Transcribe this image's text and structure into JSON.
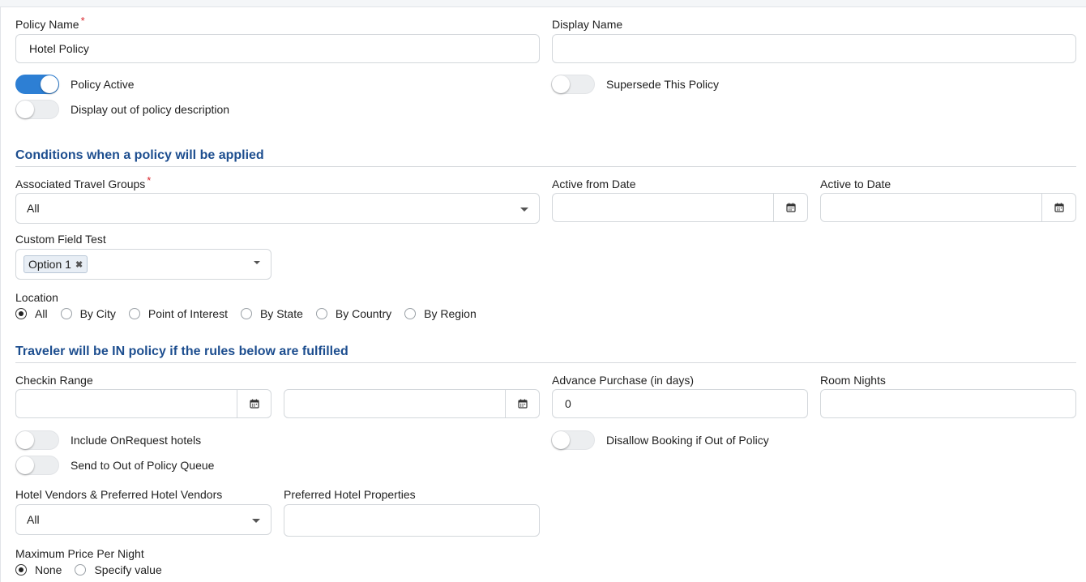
{
  "general": {
    "policy_name_label": "Policy Name",
    "policy_name_value": "Hotel Policy",
    "display_name_label": "Display Name",
    "display_name_value": "",
    "required_mark": "*",
    "policy_active_label": "Policy Active",
    "policy_active_on": true,
    "supersede_label": "Supersede This Policy",
    "supersede_on": false,
    "display_oop_label": "Display out of policy description",
    "display_oop_on": false
  },
  "conditions": {
    "title": "Conditions when a policy will be applied",
    "travel_groups_label": "Associated Travel Groups",
    "travel_groups_value": "All",
    "active_from_label": "Active from Date",
    "active_from_value": "",
    "active_to_label": "Active to Date",
    "active_to_value": "",
    "custom_field_label": "Custom Field Test",
    "custom_field_chip": "Option 1",
    "location_label": "Location",
    "location_options": [
      "All",
      "By City",
      "Point of Interest",
      "By State",
      "By Country",
      "By Region"
    ],
    "location_selected": "All"
  },
  "rules": {
    "title": "Traveler will be IN policy if the rules below are fulfilled",
    "checkin_label": "Checkin Range",
    "checkin_from_value": "",
    "checkin_to_value": "",
    "advance_purchase_label": "Advance Purchase (in days)",
    "advance_purchase_value": "0",
    "room_nights_label": "Room Nights",
    "room_nights_value": "",
    "include_onrequest_label": "Include OnRequest hotels",
    "include_onrequest_on": false,
    "disallow_label": "Disallow Booking if Out of Policy",
    "disallow_on": false,
    "send_queue_label": "Send to Out of Policy Queue",
    "send_queue_on": false,
    "vendors_label": "Hotel Vendors & Preferred Hotel Vendors",
    "vendors_value": "All",
    "preferred_props_label": "Preferred Hotel Properties",
    "preferred_props_value": "",
    "max_price_label": "Maximum Price Per Night",
    "max_price_options": [
      "None",
      "Specify value"
    ],
    "max_price_selected": "None"
  },
  "colors": {
    "accent": "#2d7fd4",
    "section_title": "#1d4e8f",
    "required": "#d9262c"
  }
}
